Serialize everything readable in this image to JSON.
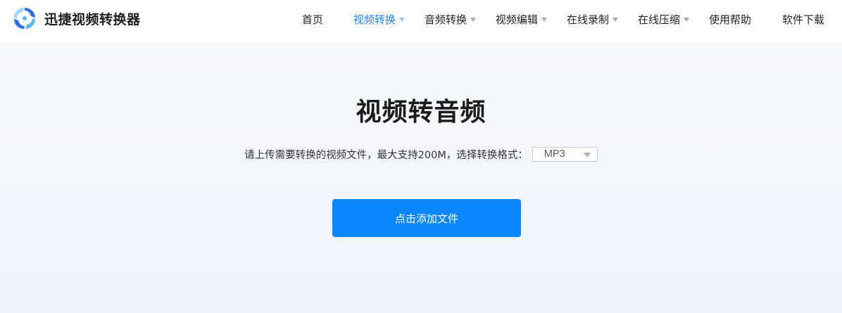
{
  "brand": {
    "name": "迅捷视频转换器",
    "logo_icon": "swirl-logo-icon",
    "logo_colors": [
      "#2f6de1",
      "#58b8f5",
      "#9fd6ff"
    ]
  },
  "nav": {
    "items": [
      {
        "label": "首页",
        "dropdown": false,
        "active": false
      },
      {
        "label": "视频转换",
        "dropdown": true,
        "active": true
      },
      {
        "label": "音频转换",
        "dropdown": true,
        "active": false
      },
      {
        "label": "视频编辑",
        "dropdown": true,
        "active": false
      },
      {
        "label": "在线录制",
        "dropdown": true,
        "active": false
      },
      {
        "label": "在线压缩",
        "dropdown": true,
        "active": false
      },
      {
        "label": "使用帮助",
        "dropdown": false,
        "active": false
      },
      {
        "label": "软件下载",
        "dropdown": false,
        "active": false
      }
    ],
    "active_color": "#1e86ff"
  },
  "main": {
    "title": "视频转音频",
    "description": "请上传需要转换的视频文件，最大支持200M，选择转换格式：",
    "format_select": {
      "value": "MP3",
      "icon": "caret-down-icon"
    },
    "add_button_label": "点击添加文件",
    "accent_color": "#0a86ff"
  }
}
